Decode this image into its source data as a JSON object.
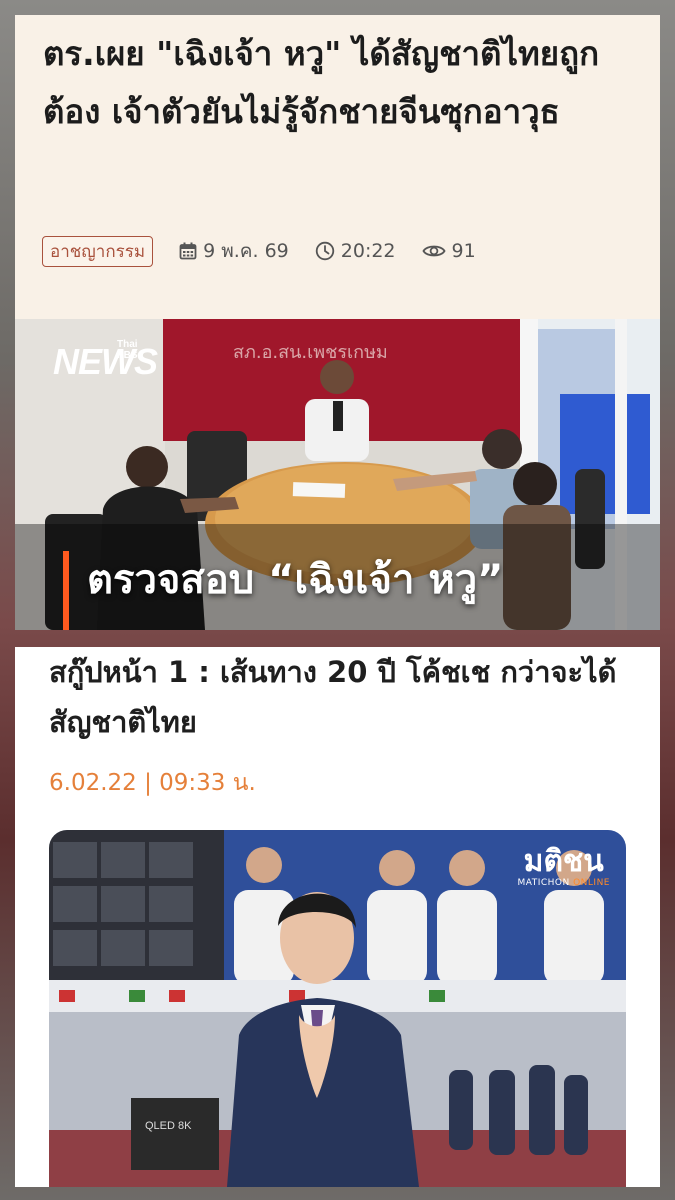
{
  "article1": {
    "title": "ตร.เผย \"เฉิงเจ้า หวู\" ได้สัญชาติไทยถูกต้อง เจ้าตัวยันไม่รู้จักชายจีนซุกอาวุธ",
    "category": "อาชญากรรม",
    "date": "9 พ.ค. 69",
    "time": "20:22",
    "views": "91",
    "image": {
      "logo_small": "Thai PBS",
      "logo_big": "NEWS",
      "wall_sign": "สภ.อ.สน.เพชรเกษม",
      "caption": "ตรวจสอบ “เฉิงเจ้า หวู”"
    },
    "icons": [
      "calendar-icon",
      "clock-icon",
      "eye-icon"
    ],
    "accent_color": "#a9523d",
    "brand_color": "#ff5a1f"
  },
  "article2": {
    "title": "สกู๊ปหน้า 1 : เส้นทาง 20 ปี โค้ชเช กว่าจะได้สัญชาติไทย",
    "date_line": "6.02.22 | 09:33 น.",
    "date_color": "#e5803a",
    "image": {
      "logo_main": "มติชน",
      "logo_sub_1": "MATICHON ",
      "logo_sub_2": "ONLINE",
      "tv_label": "QLED 8K"
    }
  }
}
